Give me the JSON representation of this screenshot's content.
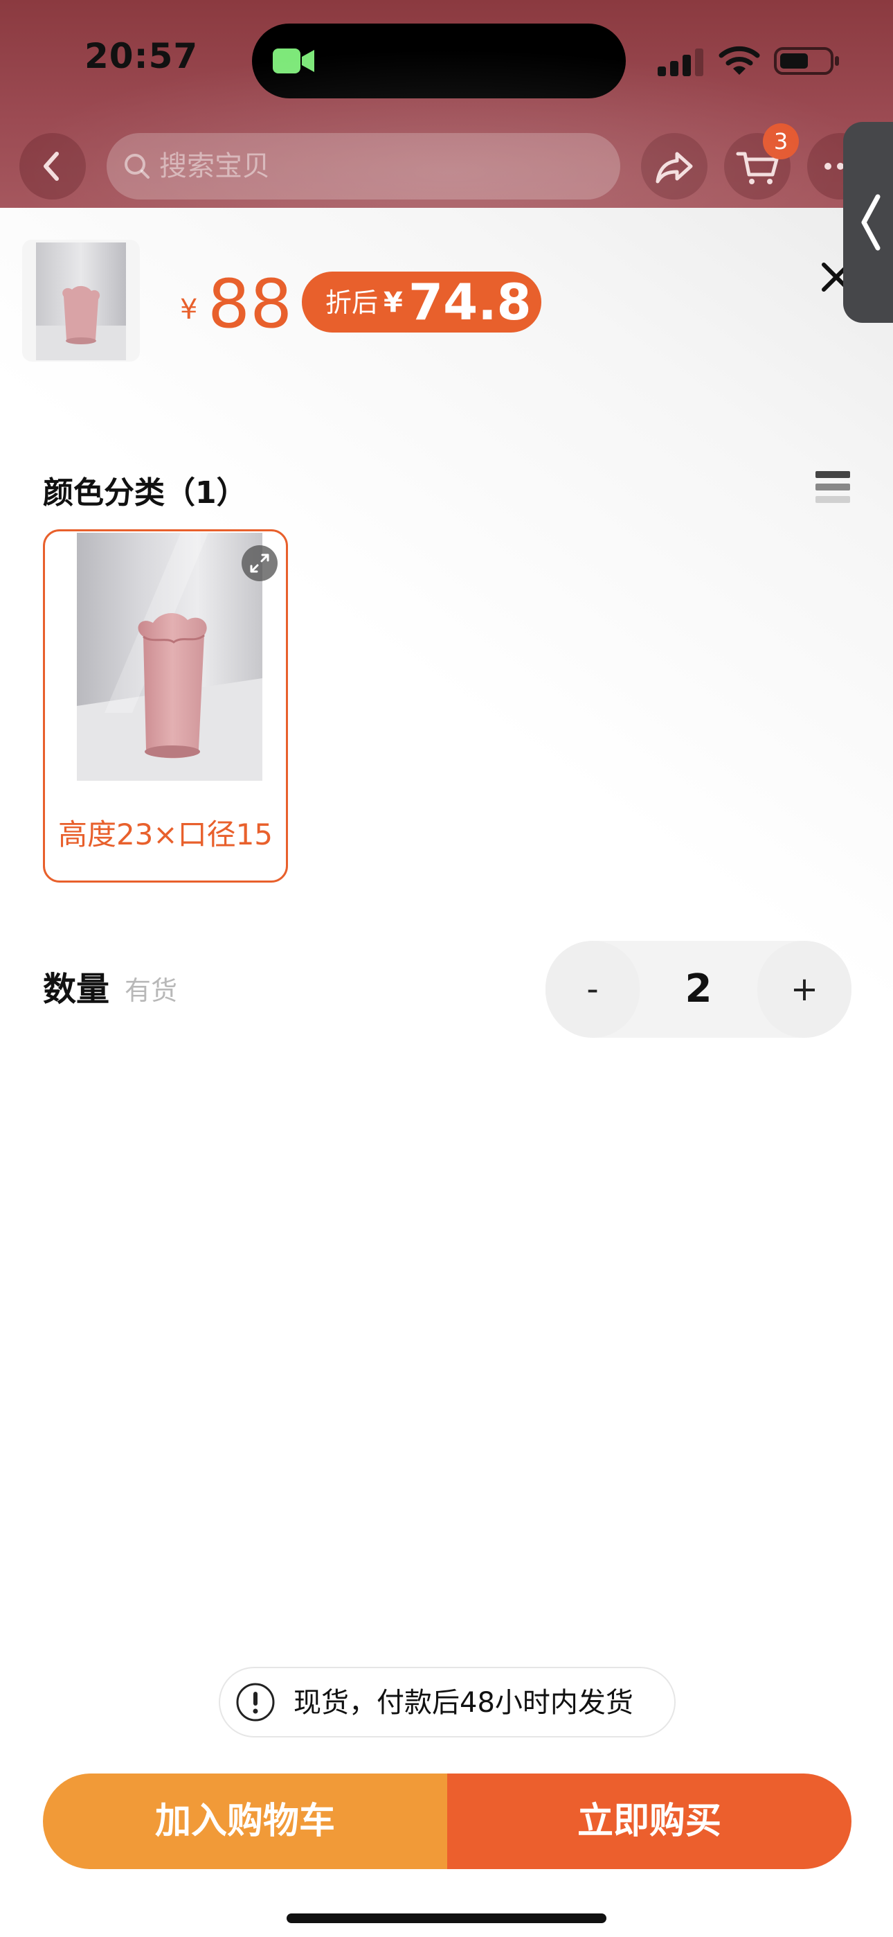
{
  "status_bar": {
    "time": "20:57"
  },
  "nav": {
    "search_placeholder": "搜索宝贝",
    "cart_badge": "3"
  },
  "product": {
    "price_currency": "¥",
    "price": "88",
    "discount_label": "折后",
    "discount_currency": "¥",
    "discount_price": "74.8"
  },
  "sku": {
    "section_title": "颜色分类（1）",
    "options": [
      {
        "label": "高度23×口径15",
        "selected": true
      }
    ]
  },
  "quantity": {
    "label": "数量",
    "stock": "有货",
    "minus": "-",
    "value": "2",
    "plus": "+"
  },
  "notice": {
    "text": "现货，付款后48小时内发货"
  },
  "actions": {
    "add_to_cart": "加入购物车",
    "buy_now": "立即购买"
  },
  "colors": {
    "accent": "#e8602c",
    "add_cart": "#f19a38",
    "buy_now": "#ec5f2d",
    "header_bg": "#8b3a40"
  },
  "icons": {
    "status": [
      "camera-icon",
      "signal-icon",
      "wifi-icon",
      "battery-icon"
    ],
    "nav": [
      "back-icon",
      "search-icon",
      "share-icon",
      "cart-icon",
      "more-icon"
    ],
    "sheet": [
      "close-icon",
      "list-view-icon",
      "expand-icon",
      "info-icon",
      "chevron-left-icon"
    ]
  }
}
